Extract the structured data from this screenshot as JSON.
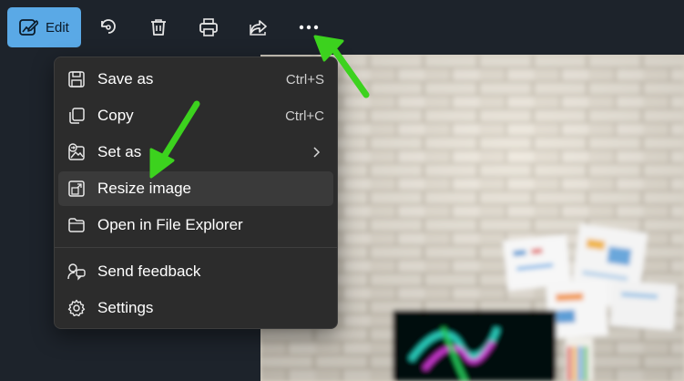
{
  "toolbar": {
    "edit_label": "Edit",
    "buttons": [
      {
        "name": "rotate-icon"
      },
      {
        "name": "trash-icon"
      },
      {
        "name": "print-icon"
      },
      {
        "name": "share-icon"
      },
      {
        "name": "more-options-icon"
      }
    ]
  },
  "menu": {
    "items": [
      {
        "label": "Save as",
        "shortcut": "Ctrl+S",
        "icon": "save-icon"
      },
      {
        "label": "Copy",
        "shortcut": "Ctrl+C",
        "icon": "copy-icon"
      },
      {
        "label": "Set as",
        "icon": "set-as-icon",
        "submenu": "chevron-right-icon"
      },
      {
        "label": "Resize image",
        "icon": "resize-image-icon",
        "highlighted": true
      },
      {
        "label": "Open in File Explorer",
        "icon": "folder-icon"
      },
      {
        "label": "Send feedback",
        "icon": "feedback-icon"
      },
      {
        "label": "Settings",
        "icon": "gear-icon"
      }
    ]
  },
  "colors": {
    "background": "#1d232b",
    "edit_button": "#5aa9e6",
    "menu_background": "#2c2c2c",
    "menu_hover": "#3a3a3a",
    "annotation_arrow": "#3cd21e"
  }
}
